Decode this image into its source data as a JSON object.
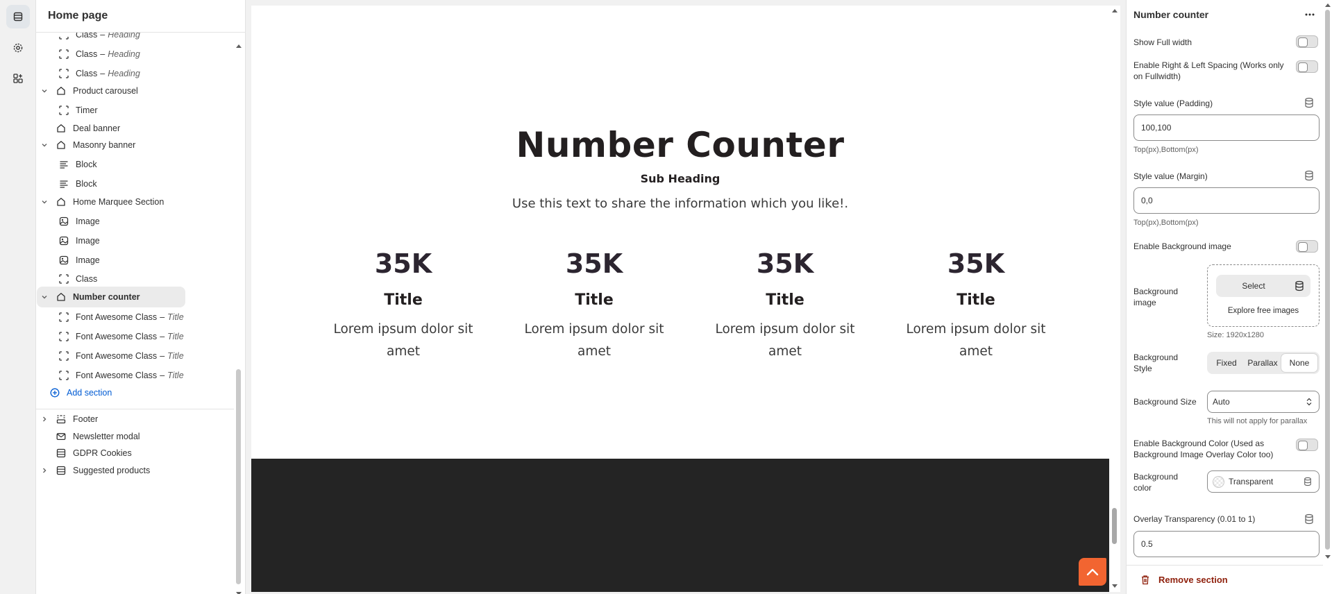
{
  "sidebar_nav": {
    "icons": [
      "sections-icon",
      "settings-gear-icon",
      "apps-icon"
    ]
  },
  "tree": {
    "title": "Home page",
    "rows": [
      {
        "label": "Class",
        "suffix": "Heading",
        "icon": "block-dashed-icon",
        "level": 2
      },
      {
        "label": "Class",
        "suffix": "Heading",
        "icon": "block-dashed-icon",
        "level": 2
      },
      {
        "label": "Class",
        "suffix": "Heading",
        "icon": "block-dashed-icon",
        "level": 2
      },
      {
        "label": "Product carousel",
        "icon": "section-icon",
        "level": 1,
        "expanded": true
      },
      {
        "label": "Timer",
        "icon": "block-dashed-icon",
        "level": 2
      },
      {
        "label": "Deal banner",
        "icon": "section-icon",
        "level": 1
      },
      {
        "label": "Masonry banner",
        "icon": "section-icon",
        "level": 1,
        "expanded": true
      },
      {
        "label": "Block",
        "icon": "text-lines-icon",
        "level": 2
      },
      {
        "label": "Block",
        "icon": "text-lines-icon",
        "level": 2
      },
      {
        "label": "Home Marquee Section",
        "icon": "section-icon",
        "level": 1,
        "expanded": true
      },
      {
        "label": "Image",
        "icon": "image-icon",
        "level": 2
      },
      {
        "label": "Image",
        "icon": "image-icon",
        "level": 2
      },
      {
        "label": "Image",
        "icon": "image-icon",
        "level": 2
      },
      {
        "label": "Class",
        "icon": "block-dashed-icon",
        "level": 2
      },
      {
        "label": "Number counter",
        "icon": "section-icon",
        "level": 1,
        "expanded": true,
        "selected": true
      },
      {
        "label": "Font Awesome Class",
        "suffix": "Title",
        "icon": "block-dashed-icon",
        "level": 2
      },
      {
        "label": "Font Awesome Class",
        "suffix": "Title",
        "icon": "block-dashed-icon",
        "level": 2
      },
      {
        "label": "Font Awesome Class",
        "suffix": "Title",
        "icon": "block-dashed-icon",
        "level": 2
      },
      {
        "label": "Font Awesome Class",
        "suffix": "Title",
        "icon": "block-dashed-icon",
        "level": 2
      }
    ],
    "add_section": "Add section",
    "footer_rows": [
      {
        "label": "Footer",
        "icon": "footer-icon",
        "collapsed": true
      },
      {
        "label": "Newsletter modal",
        "icon": "mail-icon"
      },
      {
        "label": "GDPR Cookies",
        "icon": "list-icon"
      },
      {
        "label": "Suggested products",
        "icon": "list-icon",
        "collapsed": true
      }
    ],
    "separator": "–"
  },
  "preview": {
    "heading": "Number Counter",
    "sub_heading": "Sub Heading",
    "description": "Use this text to share the information which you like!.",
    "counters": [
      {
        "number": "35K",
        "title": "Title",
        "text": "Lorem ipsum dolor sit amet"
      },
      {
        "number": "35K",
        "title": "Title",
        "text": "Lorem ipsum dolor sit amet"
      },
      {
        "number": "35K",
        "title": "Title",
        "text": "Lorem ipsum dolor sit amet"
      },
      {
        "number": "35K",
        "title": "Title",
        "text": "Lorem ipsum dolor sit amet"
      }
    ],
    "fab_icon": "chevron-up-icon",
    "colors": {
      "fab": "#f26531",
      "dark_band": "#242424"
    }
  },
  "settings": {
    "title": "Number counter",
    "show_full_width": "Show Full width",
    "enable_spacing": "Enable Right & Left Spacing (Works only on Fullwidth)",
    "padding_label": "Style value (Padding)",
    "padding_value": "100,100",
    "padding_hint": "Top(px),Bottom(px)",
    "margin_label": "Style value (Margin)",
    "margin_value": "0,0",
    "margin_hint": "Top(px),Bottom(px)",
    "enable_bg_image": "Enable Background image",
    "bg_image_label": "Background image",
    "select": "Select",
    "explore": "Explore free images",
    "size_hint": "Size: 1920x1280",
    "bg_style_label": "Background Style",
    "bg_style_options": [
      "Fixed",
      "Parallax",
      "None"
    ],
    "bg_style_selected": "None",
    "bg_size_label": "Background Size",
    "bg_size_value": "Auto",
    "bg_size_hint": "This will not apply for parallax",
    "enable_bg_color": "Enable Background Color (Used as Background Image Overlay Color too)",
    "bg_color_label": "Background color",
    "bg_color_value": "Transparent",
    "overlay_label": "Overlay Transparency (0.01 to 1)",
    "overlay_value": "0.5",
    "remove_section": "Remove section",
    "colors": {
      "remove": "#8e1f0b",
      "link": "#005bd3"
    }
  }
}
